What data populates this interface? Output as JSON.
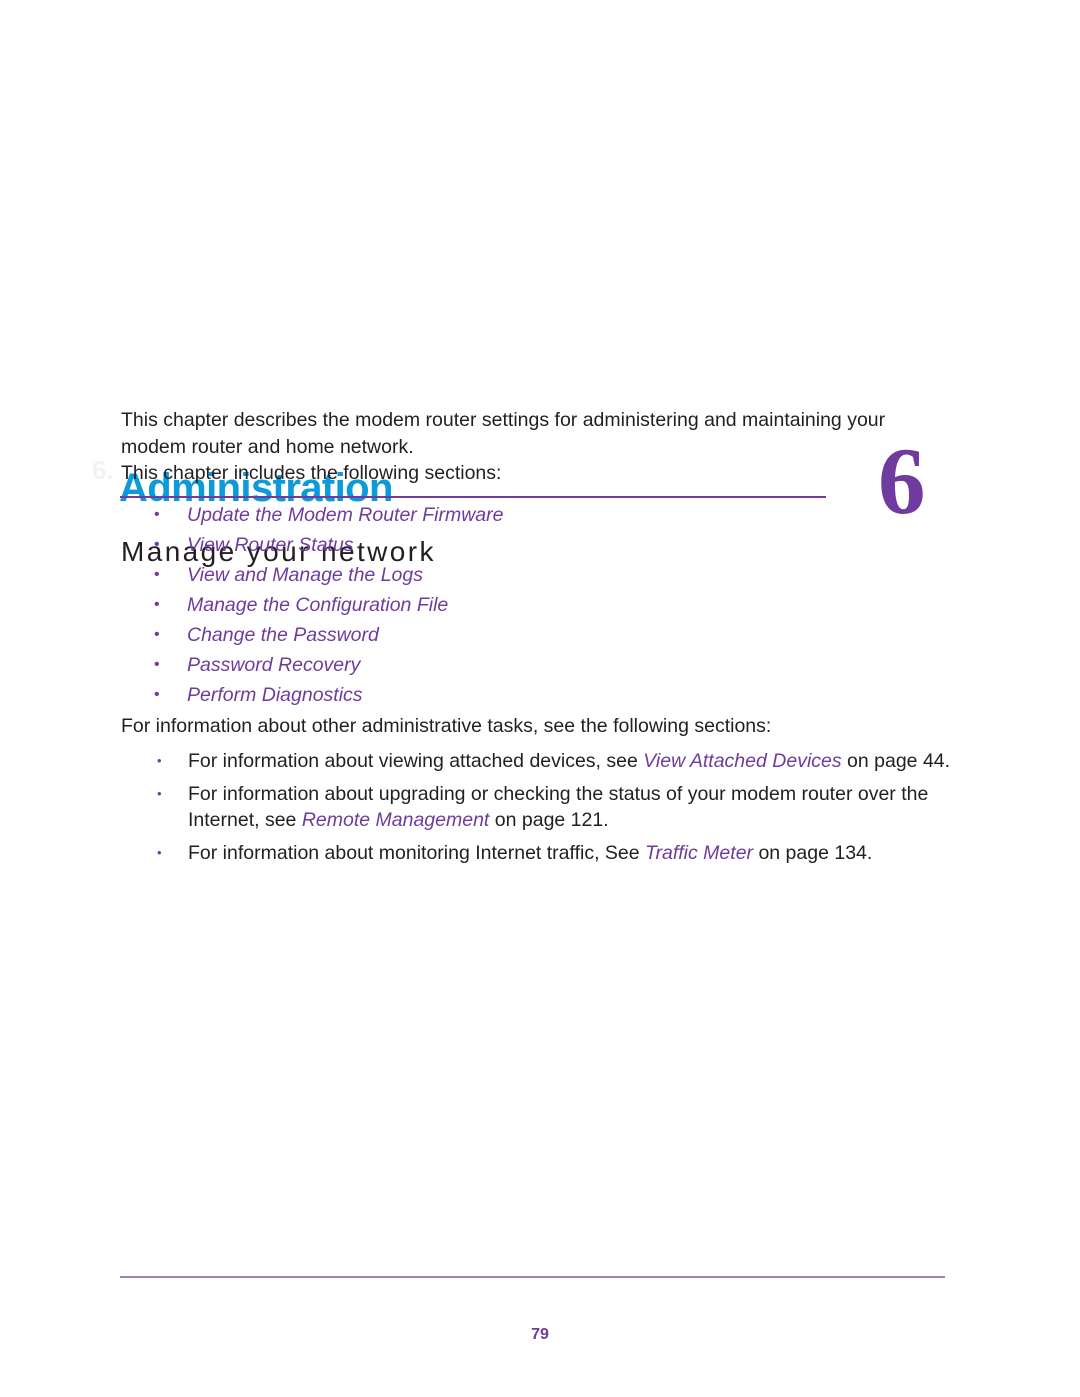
{
  "document": {
    "chapter_number": "6",
    "chapter_watermark": "6.",
    "title": "Administration",
    "subtitle": "Manage your network",
    "colors": {
      "title_blue": "#0b9ada",
      "accent_purple": "#6f3b9e",
      "rule_purple": "#9a7ebf",
      "body_text": "#231f20"
    }
  },
  "intro": {
    "paragraph_1": "This chapter describes the modem router settings for administering and maintaining your modem router and home network.",
    "paragraph_2": "This chapter includes the following sections:"
  },
  "section_links": {
    "bullet": "•",
    "items": [
      {
        "label": "Update the Modem Router Firmware"
      },
      {
        "label": "View Router Status"
      },
      {
        "label": "View and Manage the Logs"
      },
      {
        "label": "Manage the Configuration File"
      },
      {
        "label": "Change the Password"
      },
      {
        "label": "Password Recovery"
      },
      {
        "label": "Perform Diagnostics"
      }
    ]
  },
  "other_tasks": {
    "lead_in": "For information about other administrative tasks, see the following sections:",
    "bullet": "•",
    "items": [
      {
        "before": "For information about viewing attached devices, see ",
        "link": "View Attached Devices",
        "after": " on page 44."
      },
      {
        "before": "For information about upgrading or checking the status of your modem router over the Internet, see ",
        "link": "Remote Management",
        "after": " on page 121."
      },
      {
        "before": "For information about monitoring Internet traffic, See ",
        "link": "Traffic Meter",
        "after": " on page 134."
      }
    ]
  },
  "footer": {
    "page_number": "79"
  }
}
